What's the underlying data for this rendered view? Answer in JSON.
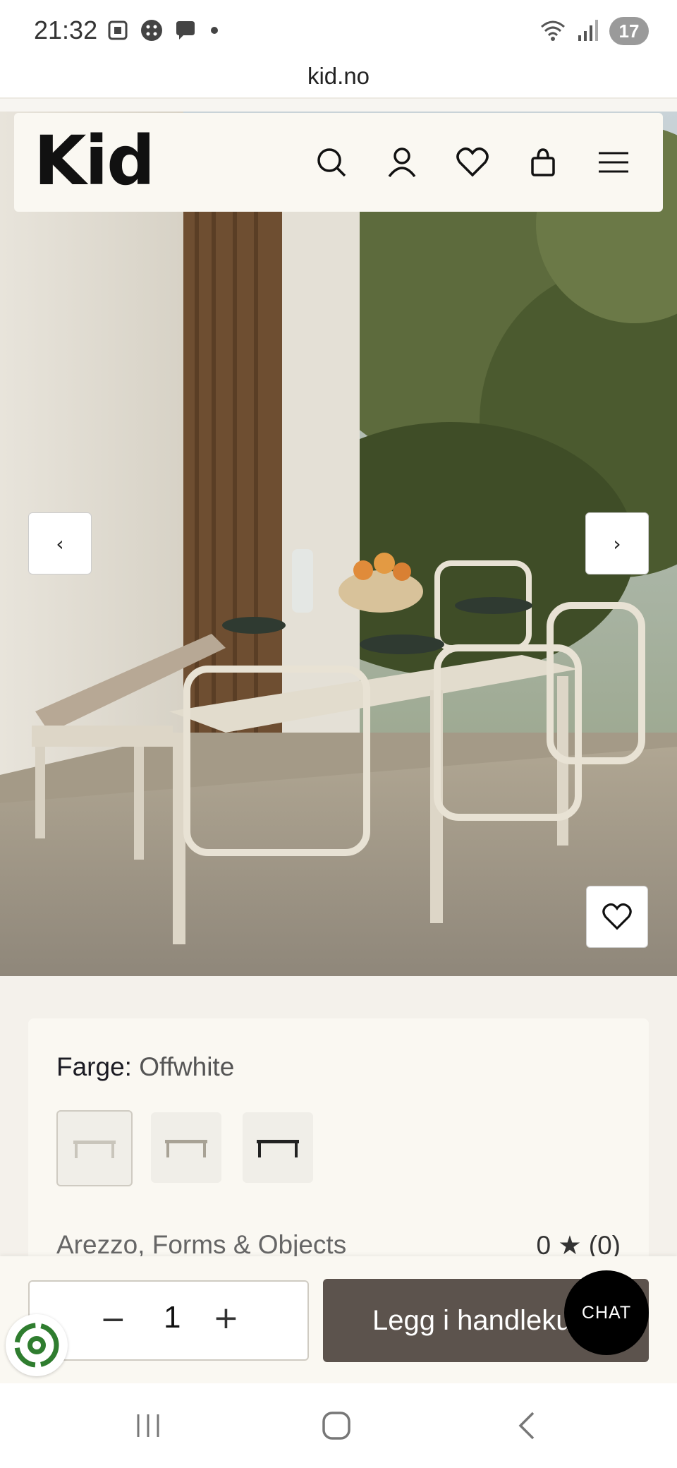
{
  "status_bar": {
    "time": "21:32",
    "battery": "17",
    "icons_left": [
      "screenshot-icon",
      "app-icon",
      "chat-notification-icon",
      "dot-icon"
    ],
    "icons_right": [
      "wifi-icon",
      "signal-icon",
      "battery-icon"
    ]
  },
  "browser": {
    "url": "kid.no"
  },
  "header": {
    "logo": "Kid",
    "icons": [
      "search-icon",
      "account-icon",
      "wishlist-icon",
      "cart-icon",
      "menu-icon"
    ]
  },
  "carousel": {
    "prev_label": "‹",
    "next_label": "›"
  },
  "product": {
    "color_label": "Farge:",
    "color_value": "Offwhite",
    "swatches": [
      "offwhite",
      "beige",
      "black"
    ],
    "name": "Arezzo, Forms & Objects",
    "rating": "0 ★ (0)"
  },
  "buy_bar": {
    "qty_minus": "−",
    "qty_value": "1",
    "qty_plus": "+",
    "add_to_cart": "Legg i handlekurv"
  },
  "chat": {
    "label": "CHAT"
  },
  "colors": {
    "cart_button": "#5c534d",
    "background": "#f4f1eb",
    "card": "#faf8f2"
  }
}
